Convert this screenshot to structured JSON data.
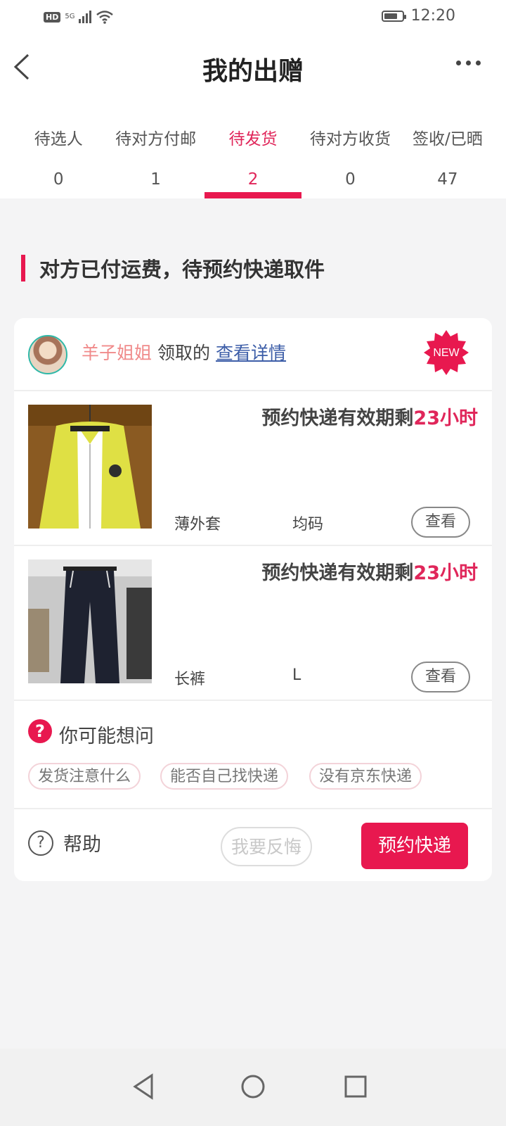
{
  "status_bar": {
    "hd": "HD",
    "network": "5G",
    "time": "12:20"
  },
  "header": {
    "title": "我的出赠"
  },
  "tabs": [
    {
      "label": "待选人",
      "count": "0"
    },
    {
      "label": "待对方付邮",
      "count": "1"
    },
    {
      "label": "待发货",
      "count": "2",
      "active": true
    },
    {
      "label": "待对方收货",
      "count": "0"
    },
    {
      "label": "签收/已晒",
      "count": "47"
    }
  ],
  "section": {
    "title": "对方已付运费，待预约快递取件"
  },
  "card": {
    "user_name": "羊子姐姐",
    "claimed_text": "领取的",
    "detail_link": "查看详情",
    "badge": "NEW",
    "items": [
      {
        "expiry_prefix": "预约快递有效期剩",
        "expiry_value": "23小时",
        "name": "薄外套",
        "size": "均码",
        "view_label": "查看"
      },
      {
        "expiry_prefix": "预约快递有效期剩",
        "expiry_value": "23小时",
        "name": "长裤",
        "size": "L",
        "view_label": "查看"
      }
    ],
    "faq": {
      "icon": "?",
      "title": "你可能想问",
      "chips": [
        "发货注意什么",
        "能否自己找快递",
        "没有京东快递"
      ]
    },
    "footer": {
      "help_label": "帮助",
      "regret_label": "我要反悔",
      "book_label": "预约快递"
    }
  },
  "colors": {
    "accent": "#e8184f",
    "username": "#f08a8a",
    "link": "#3d5ea8",
    "background": "#f4f4f5"
  }
}
